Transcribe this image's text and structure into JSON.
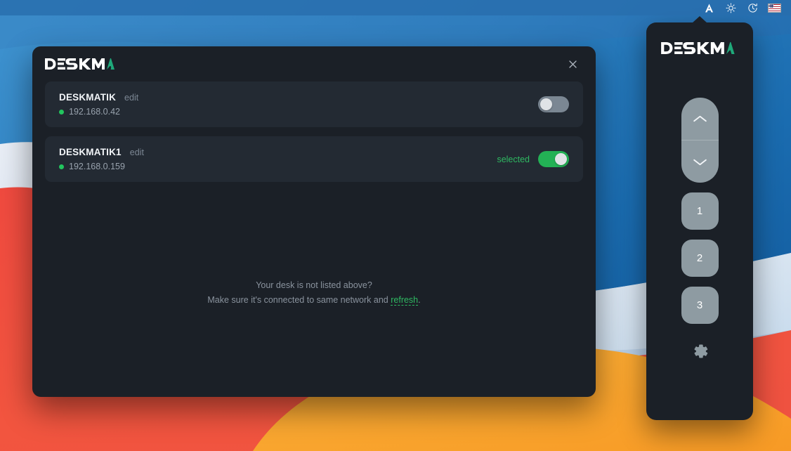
{
  "menubar": {
    "items": [
      {
        "name": "app-icon",
        "icon": "deskmatik-triangle-icon",
        "label": ""
      },
      {
        "name": "brightness",
        "icon": "sun-icon",
        "label": ""
      },
      {
        "name": "time-machine",
        "icon": "clock-icon",
        "label": ""
      },
      {
        "name": "input-language",
        "icon": "us-flag-icon",
        "label": ""
      }
    ]
  },
  "modal": {
    "logo_text": "DESKMATIK",
    "close_label": "×",
    "devices": [
      {
        "name": "DESKMATIK",
        "edit_label": "edit",
        "ip": "192.168.0.42",
        "status": "online",
        "selected": false,
        "selected_label": ""
      },
      {
        "name": "DESKMATIK1",
        "edit_label": "edit",
        "ip": "192.168.0.159",
        "status": "online",
        "selected": true,
        "selected_label": "selected"
      }
    ],
    "footer": {
      "line1": "Your desk is not listed above?",
      "line2_prefix": "Make sure it's connected to same network and ",
      "refresh_label": "refresh",
      "line2_suffix": "."
    }
  },
  "side_panel": {
    "logo_text": "DESKMATIK",
    "up_label": "up",
    "down_label": "down",
    "presets": [
      {
        "label": "1"
      },
      {
        "label": "2"
      },
      {
        "label": "3"
      }
    ],
    "settings_label": "settings"
  },
  "colors": {
    "accent_green": "#22c55e",
    "toggle_on": "#23b155",
    "toggle_off": "#7b8793",
    "panel_bg": "#1b2027",
    "card_bg": "#232a33",
    "button_gray": "#8e9ba2",
    "logo_accent": "#1fa97a"
  }
}
